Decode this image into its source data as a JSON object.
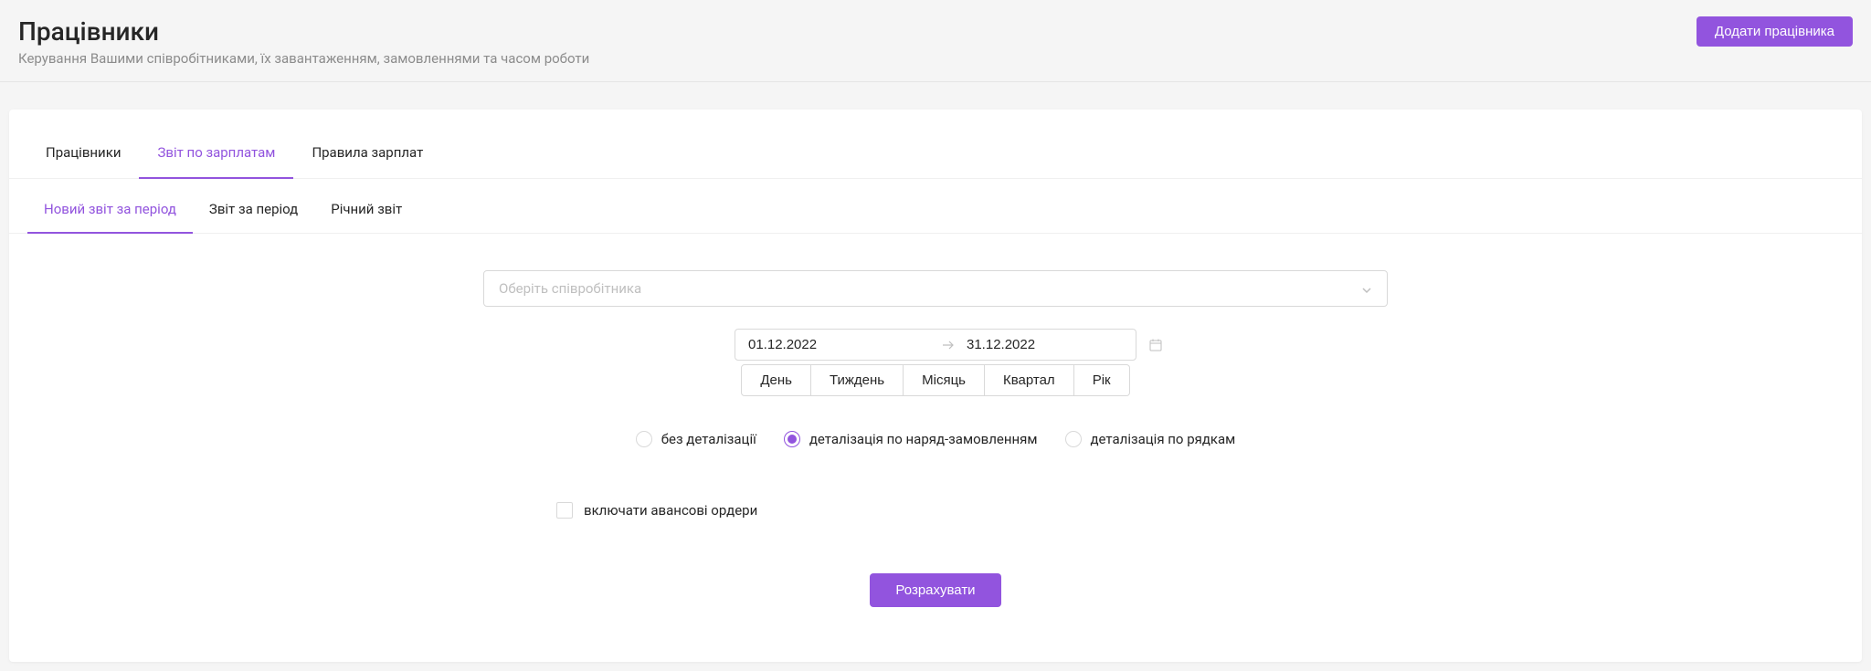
{
  "header": {
    "title": "Працівники",
    "subtitle": "Керування Вашими співробітниками, їх завантаженням, замовленнями та часом роботи",
    "add_button": "Додати працівника"
  },
  "tabs": {
    "employees": "Працівники",
    "salary_report": "Звіт по зарплатам",
    "salary_rules": "Правила зарплат"
  },
  "subtabs": {
    "new_period": "Новий звіт за період",
    "period": "Звіт за період",
    "annual": "Річний звіт"
  },
  "form": {
    "employee_placeholder": "Оберіть співробітника",
    "date_from": "01.12.2022",
    "date_to": "31.12.2022",
    "periods": {
      "day": "День",
      "week": "Тиждень",
      "month": "Місяць",
      "quarter": "Квартал",
      "year": "Рік"
    },
    "detail": {
      "none": "без деталізації",
      "orders": "деталізація по наряд-замовленням",
      "lines": "деталізація по рядкам"
    },
    "include_advance": "включати авансові ордери",
    "calculate": "Розрахувати"
  }
}
